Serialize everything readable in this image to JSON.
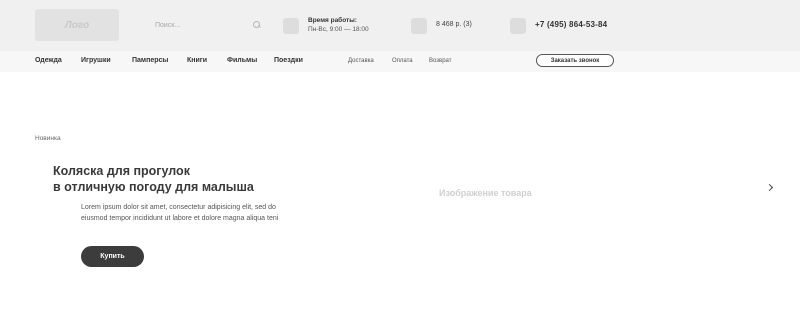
{
  "header": {
    "logo": "Лого",
    "search_placeholder": "Поиск...",
    "hours_title": "Время работы:",
    "hours_value": "Пн-Вс, 9:00 — 18:00",
    "cart": "8 468 р. (3)",
    "phone": "+7 (495) 864-53-84"
  },
  "nav": {
    "items": [
      "Одежда",
      "Игрушки",
      "Памперсы",
      "Книги",
      "Фильмы",
      "Поездки"
    ],
    "sub_items": [
      "Доставка",
      "Оплата",
      "Возврат"
    ],
    "callback_label": "Заказать звонок"
  },
  "hero": {
    "badge": "Новинка",
    "headline_line1": "Коляска для прогулок",
    "headline_line2": "в отличную погоду для малыша",
    "description": "Lorem ipsum dolor sit amet, consectetur adipisicing elit, sed do eiusmod tempor incididunt ut labore et dolore magna aliqua teni",
    "buy_label": "Купить",
    "image_label": "Изображение товара"
  }
}
